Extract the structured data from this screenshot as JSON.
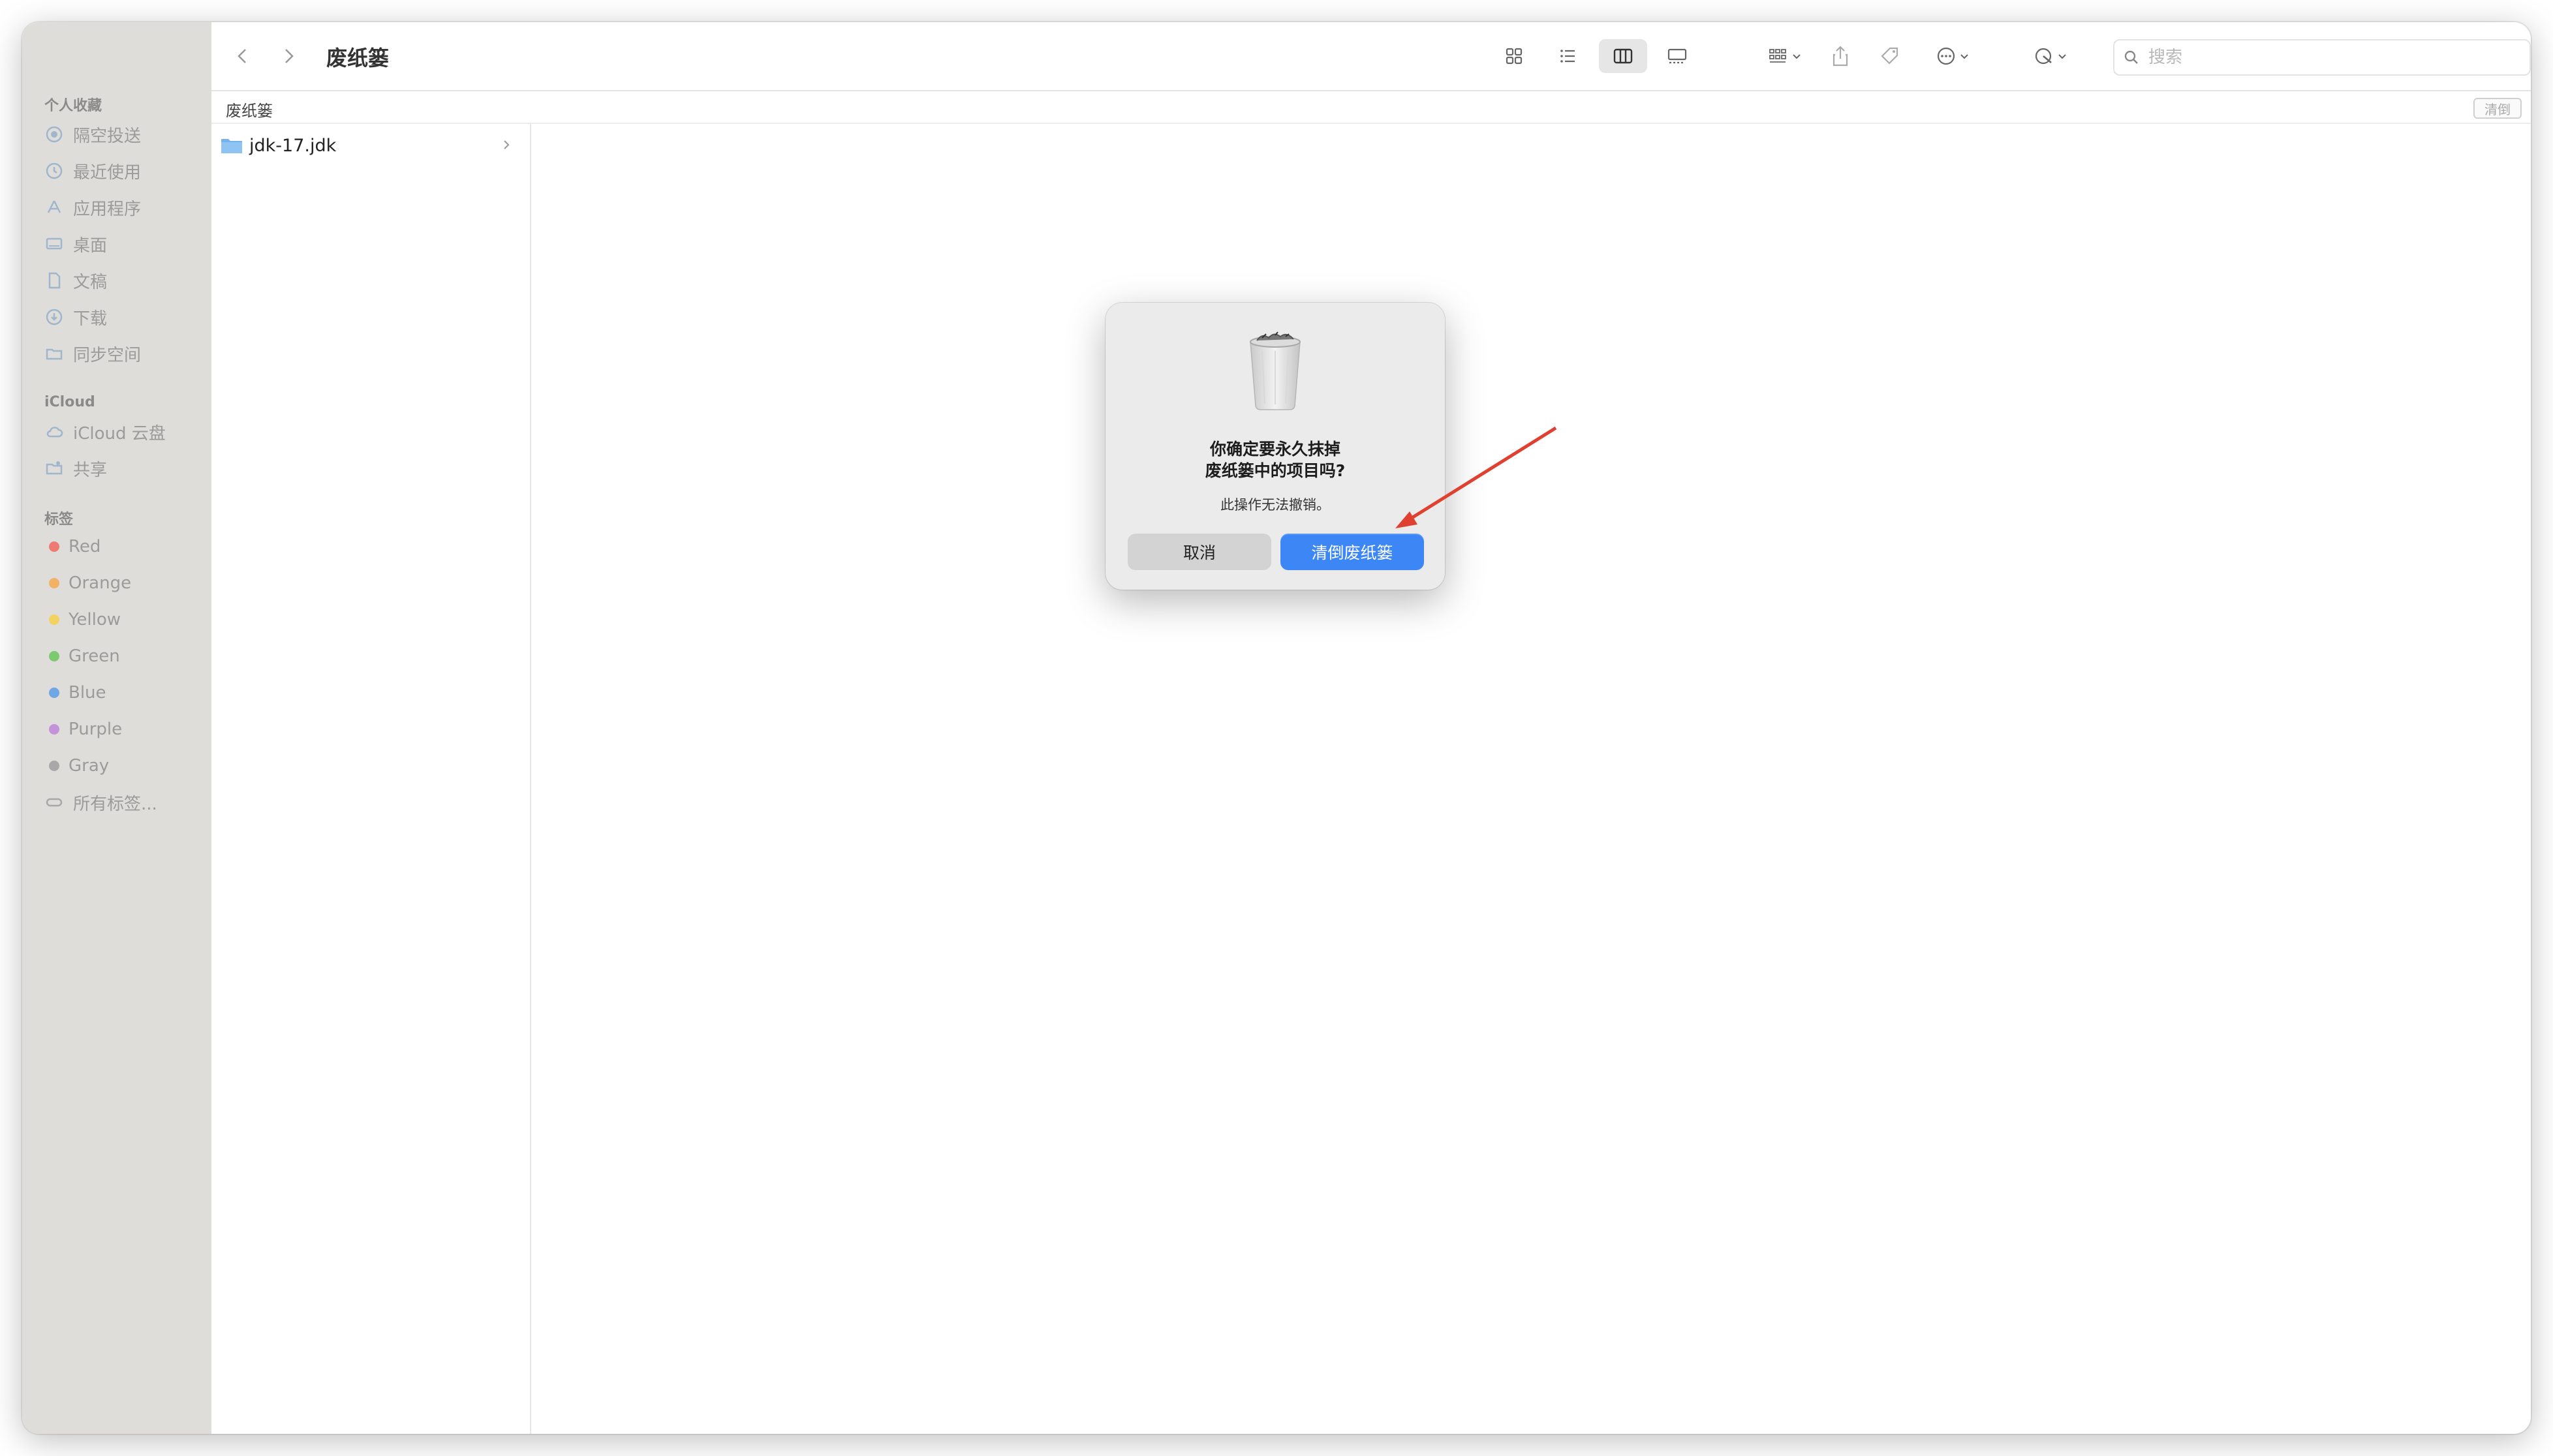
{
  "window": {
    "title": "废纸篓"
  },
  "sidebar": {
    "favorites_header": "个人收藏",
    "favorites": [
      {
        "label": "隔空投送",
        "icon": "airdrop-icon"
      },
      {
        "label": "最近使用",
        "icon": "clock-icon"
      },
      {
        "label": "应用程序",
        "icon": "applications-icon"
      },
      {
        "label": "桌面",
        "icon": "desktop-icon"
      },
      {
        "label": "文稿",
        "icon": "document-icon"
      },
      {
        "label": "下载",
        "icon": "download-icon"
      },
      {
        "label": "同步空间",
        "icon": "folder-icon"
      }
    ],
    "icloud_header": "iCloud",
    "icloud": [
      {
        "label": "iCloud 云盘",
        "icon": "cloud-icon"
      },
      {
        "label": "共享",
        "icon": "shared-folder-icon"
      }
    ],
    "tags_header": "标签",
    "tags": [
      {
        "label": "Red",
        "color": "#ee7b72"
      },
      {
        "label": "Orange",
        "color": "#f2b266"
      },
      {
        "label": "Yellow",
        "color": "#f2d362"
      },
      {
        "label": "Green",
        "color": "#7dc96f"
      },
      {
        "label": "Blue",
        "color": "#6fa6e6"
      },
      {
        "label": "Purple",
        "color": "#c392d9"
      },
      {
        "label": "Gray",
        "color": "#a8a8a8"
      }
    ],
    "all_tags": "所有标签..."
  },
  "toolbar": {
    "search_placeholder": "搜索",
    "view_modes": [
      "icon-view",
      "list-view",
      "column-view",
      "gallery-view"
    ],
    "active_view": "column-view"
  },
  "pathbar": {
    "label": "废纸篓",
    "empty_button": "清倒"
  },
  "files": [
    {
      "name": "jdk-17.jdk",
      "type": "folder"
    }
  ],
  "dialog": {
    "title_line1": "你确定要永久抹掉",
    "title_line2": "废纸篓中的项目吗?",
    "message": "此操作无法撤销。",
    "cancel_label": "取消",
    "confirm_label": "清倒废纸篓"
  },
  "colors": {
    "accent": "#3c86f5",
    "annotation_arrow": "#e0402f",
    "sidebar_bg": "#deddda"
  }
}
